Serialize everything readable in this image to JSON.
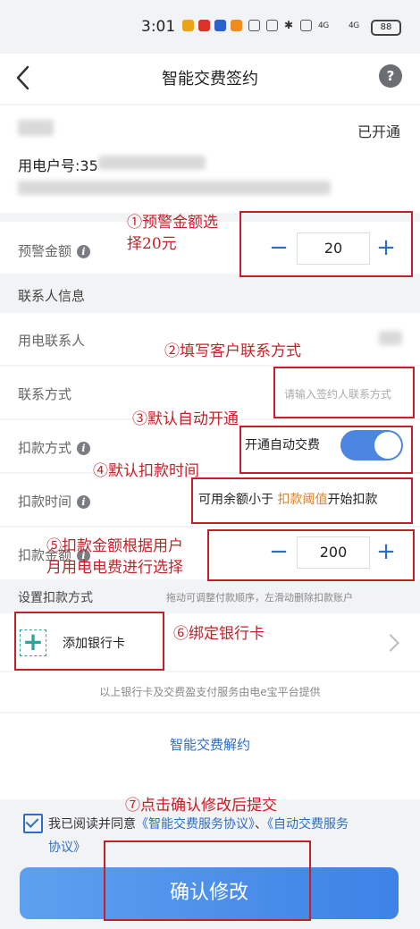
{
  "status_bar": {
    "time": "3:01",
    "battery": "88",
    "net1": "4G",
    "net2": "4G"
  },
  "header": {
    "title": "智能交费签约",
    "help": "?"
  },
  "account": {
    "status": "已开通",
    "user_no_label": "用电户号:35"
  },
  "warning": {
    "label": "预警金额",
    "value": "20",
    "minus": "−",
    "plus": "+"
  },
  "contact_section": {
    "title": "联系人信息",
    "contact_person_label": "用电联系人",
    "contact_method_label": "联系方式",
    "contact_method_placeholder": "请输入签约人联系方式"
  },
  "deduct_method": {
    "label": "扣款方式",
    "option": "开通自动交费"
  },
  "deduct_time": {
    "label": "扣款时间",
    "prefix": "可用余额小于",
    "highlight": "扣款阈值",
    "suffix": "开始扣款"
  },
  "deduct_amount": {
    "label": "扣款金额",
    "value": "200",
    "minus": "−",
    "plus": "+"
  },
  "pay_method": {
    "label": "设置扣款方式",
    "hint": "拖动可调整付款顺序，左滑动删除扣款账户",
    "add_card": "添加银行卡",
    "plus": "+"
  },
  "provider_note": "以上银行卡及交费盈支付服务由电e宝平台提供",
  "unsign_link": "智能交费解约",
  "agreement": {
    "prefix": "我已阅读并同意",
    "link1": "《智能交费服务协议》",
    "separator": "、",
    "link2a": "《自动交费服务",
    "link2b": "协议》"
  },
  "confirm_button": "确认修改",
  "annotations": {
    "a1_line1": "①预警金额选",
    "a1_line2": "择20元",
    "a2": "②填写客户联系方式",
    "a3": "③默认自动开通",
    "a4": "④默认扣款时间",
    "a5_line1": "⑤扣款金额根据用户",
    "a5_line2": "月用电电费进行选择",
    "a6": "⑥绑定银行卡",
    "a7": "⑦点击确认修改后提交"
  },
  "colors": {
    "accent": "#2c6dc5",
    "annotation": "#c81e28",
    "button": "#3d82e6"
  }
}
